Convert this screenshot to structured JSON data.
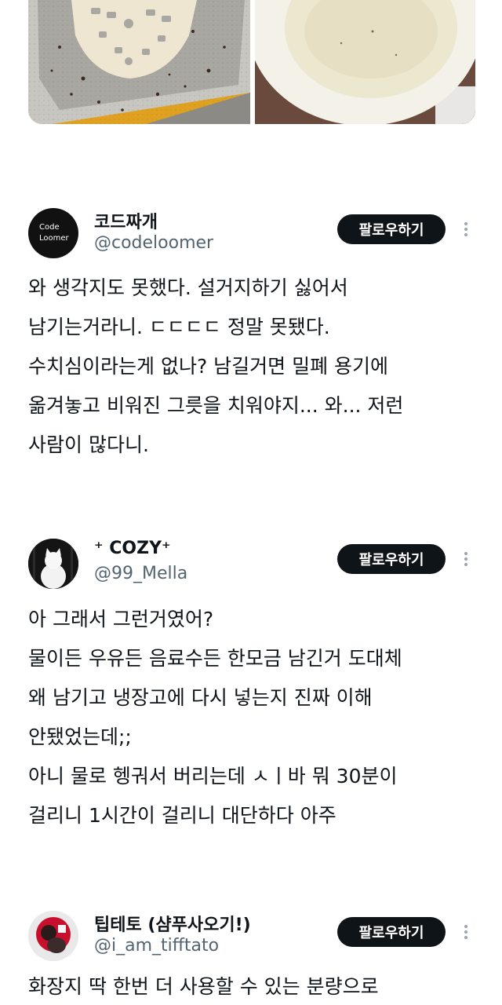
{
  "posts": [
    {
      "name": "코드짜개",
      "handle": "@codeloomer",
      "avatar_text_line1": "Code",
      "avatar_text_line2": "Loomer",
      "follow_label": "팔로우하기",
      "lines": [
        "와 생각지도 못했다. 설거지하기 싫어서",
        "남기는거라니. ㄷㄷㄷㄷ 정말 못됐다.",
        "수치심이라는게 없나? 남길거면 밀폐 용기에",
        "옮겨놓고 비워진 그릇을 치워야지... 와... 저런",
        "사람이 많다니."
      ]
    },
    {
      "name": "⁺ COZY⁺",
      "handle": "@99_Mella",
      "follow_label": "팔로우하기",
      "lines": [
        "아 그래서 그런거였어?",
        "물이든 우유든 음료수든 한모금 남긴거 도대체",
        "왜 남기고 냉장고에 다시 넣는지 진짜 이해",
        "안됐었는데;;",
        "아니 물로 헹궈서 버리는데 ㅅㅣ바 뭐 30분이",
        "걸리니 1시간이 걸리니 대단하다 아주"
      ]
    },
    {
      "name": "팁테토 (샴푸사오기!)",
      "handle": "@i_am_tifftato",
      "follow_label": "팔로우하기",
      "lines": [
        "화장지 딱 한번 더 사용할 수 있는 분량으로"
      ]
    }
  ]
}
